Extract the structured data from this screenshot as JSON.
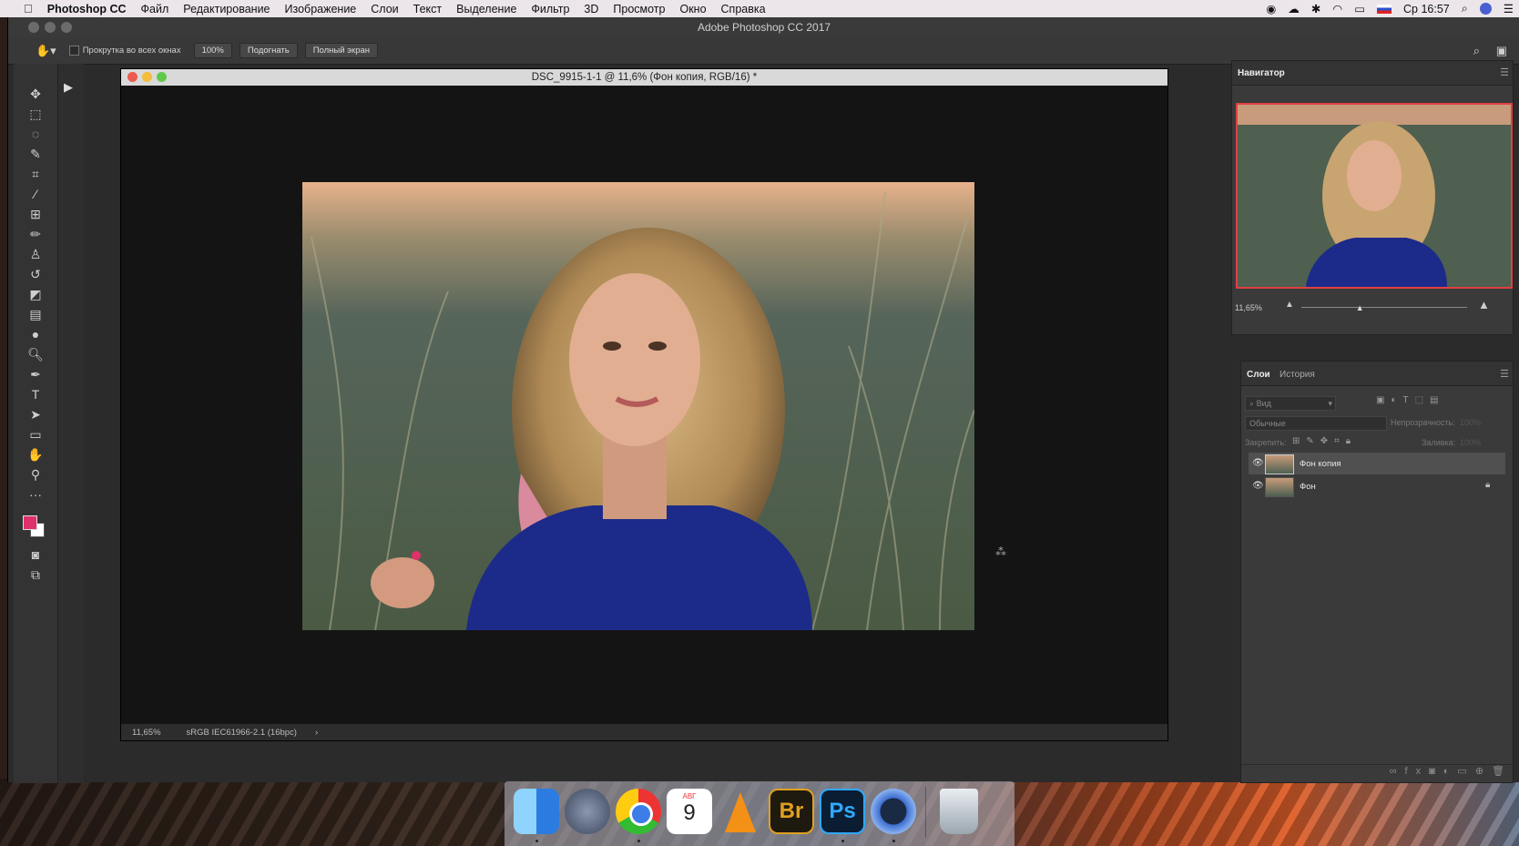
{
  "menubar": {
    "apple": "",
    "app_name": "Photoshop CC",
    "items": [
      "Файл",
      "Редактирование",
      "Изображение",
      "Слои",
      "Текст",
      "Выделение",
      "Фильтр",
      "3D",
      "Просмотр",
      "Окно",
      "Справка"
    ],
    "clock": "Ср 16:57"
  },
  "app": {
    "title": "Adobe Photoshop CC 2017"
  },
  "options_bar": {
    "scroll_all_label": "Прокрутка во всех окнах",
    "zoom_btn": "100%",
    "fit_btn": "Подогнать",
    "fullscreen_btn": "Полный экран"
  },
  "document": {
    "title": "DSC_9915-1-1 @ 11,6% (Фон копия, RGB/16) *",
    "status_zoom": "11,65%",
    "status_profile": "sRGB IEC61966-2.1 (16bpc)",
    "status_arrow": "›"
  },
  "navigator": {
    "title": "Навигатор",
    "zoom": "11,65%",
    "zoom_slider_fraction": 0.35
  },
  "layers_panel": {
    "tabs": [
      "Слои",
      "История"
    ],
    "search_placeholder": "Вид",
    "blend_mode": "Обычные",
    "opacity_label": "Непрозрачность:",
    "opacity_value": "100%",
    "lock_label": "Закрепить:",
    "fill_label": "Заливка:",
    "fill_value": "100%",
    "layers": [
      {
        "name": "Фон копия",
        "visible": true,
        "locked": false,
        "selected": true
      },
      {
        "name": "Фон",
        "visible": true,
        "locked": true,
        "selected": false
      }
    ]
  },
  "dock": {
    "calendar_month": "АВГ",
    "calendar_day": "9",
    "bridge": "Br",
    "photoshop": "Ps"
  },
  "colors": {
    "foreground": "#e0306a",
    "background": "#ffffff",
    "accent_selection": "#e04040"
  }
}
